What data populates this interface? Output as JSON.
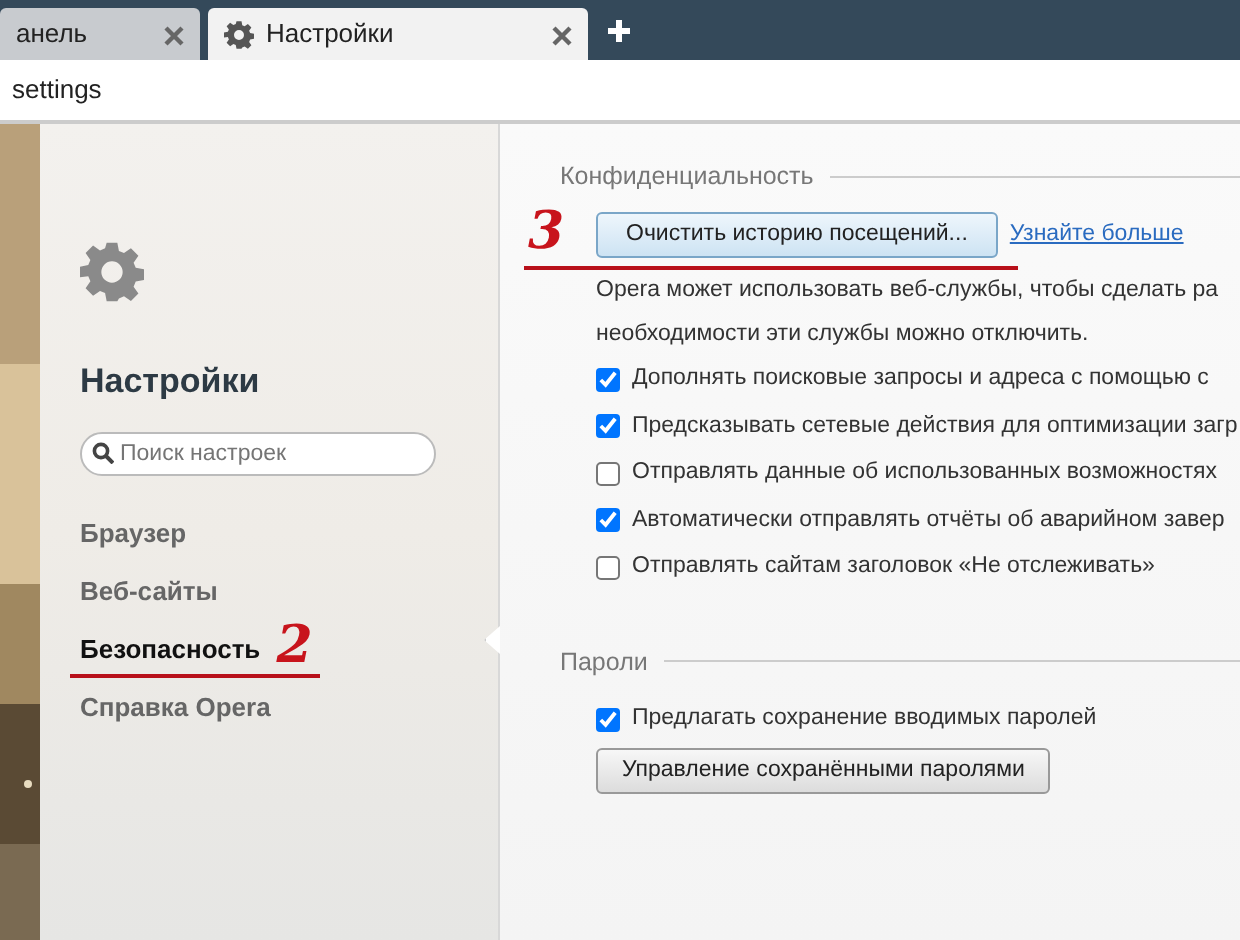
{
  "tabs": [
    {
      "label": "анель",
      "selected": false
    },
    {
      "label": "Настройки",
      "selected": true
    }
  ],
  "address_bar": {
    "value": "settings"
  },
  "sidebar": {
    "title": "Настройки",
    "search": {
      "placeholder": "Поиск настроек"
    },
    "items": [
      {
        "label": "Браузер",
        "selected": false
      },
      {
        "label": "Веб-сайты",
        "selected": false
      },
      {
        "label": "Безопасность",
        "selected": true,
        "annotation": "2"
      },
      {
        "label": "Справка Opera",
        "selected": false
      }
    ]
  },
  "sections": [
    {
      "title": "Конфиденциальность",
      "annotation": "3",
      "button": "Очистить историю посещений...",
      "link": "Узнайте больше",
      "description": [
        "Opera может использовать веб-службы, чтобы сделать ра",
        "необходимости эти службы можно отключить."
      ],
      "options": [
        {
          "label": "Дополнять поисковые запросы и адреса с помощью с",
          "checked": true
        },
        {
          "label": "Предсказывать сетевые действия для оптимизации загр",
          "checked": true
        },
        {
          "label": "Отправлять данные об использованных возможностях",
          "checked": false
        },
        {
          "label": "Автоматически отправлять отчёты об аварийном завер",
          "checked": true
        },
        {
          "label": "Отправлять сайтам заголовок «Не отслеживать»",
          "checked": false
        }
      ]
    },
    {
      "title": "Пароли",
      "options": [
        {
          "label": "Предлагать сохранение вводимых паролей",
          "checked": true
        }
      ],
      "button": "Управление сохранёнными паролями"
    }
  ]
}
